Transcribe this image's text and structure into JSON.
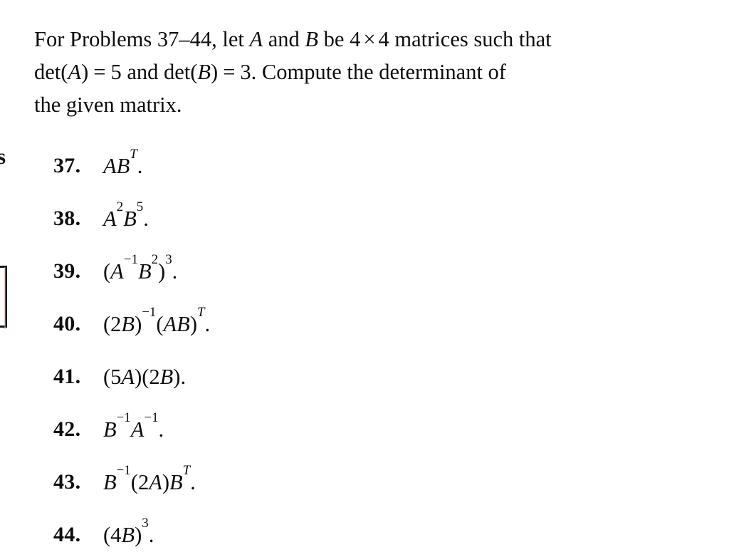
{
  "page": {
    "background_color": "#ffffff",
    "text_color": "#0d0d0d"
  },
  "edge_artifacts": {
    "partial_letter": "s",
    "partial_box_label": ""
  },
  "intro": {
    "line1_a": "For Problems 37–44, let",
    "line1_var1": "A",
    "line1_b": "and",
    "line1_var2": "B",
    "line1_c": "be 4",
    "line1_times": "×",
    "line1_d": "4 matrices such that",
    "line2_det1": "det(",
    "line2_var1": "A",
    "line2_close1": ")",
    "line2_eq1": "=",
    "line2_val1": "5",
    "line2_and": "and",
    "line2_det2": "det(",
    "line2_var2": "B",
    "line2_close2": ")",
    "line2_eq2": "=",
    "line2_val2": "3.",
    "line2_rest": "Compute the determinant of",
    "line3": "the given matrix."
  },
  "problems": [
    {
      "number": "37.",
      "expression": "AB^T.",
      "parts": [
        {
          "t": "A",
          "style": "mi"
        },
        {
          "t": "B",
          "style": "mi"
        },
        {
          "t": "T",
          "style": "sup-italic"
        },
        {
          "t": ".",
          "style": "dot"
        }
      ]
    },
    {
      "number": "38.",
      "expression": "A^2B^5.",
      "parts": [
        {
          "t": "A",
          "style": "mi"
        },
        {
          "t": "2",
          "style": "sup-upright"
        },
        {
          "t": "B",
          "style": "mi"
        },
        {
          "t": "5",
          "style": "sup-upright"
        },
        {
          "t": ".",
          "style": "dot"
        }
      ]
    },
    {
      "number": "39.",
      "expression": "(A^-1 B^2)^3.",
      "parts": [
        {
          "t": "(",
          "style": "paren"
        },
        {
          "t": "A",
          "style": "mi"
        },
        {
          "t": "−1",
          "style": "sup-upright"
        },
        {
          "t": "B",
          "style": "mi"
        },
        {
          "t": "2",
          "style": "sup-upright"
        },
        {
          "t": ")",
          "style": "paren"
        },
        {
          "t": "3",
          "style": "sup-upright"
        },
        {
          "t": ".",
          "style": "dot"
        }
      ]
    },
    {
      "number": "40.",
      "expression": "(2B)^-1(AB)^T.",
      "parts": [
        {
          "t": "(",
          "style": "paren"
        },
        {
          "t": "2",
          "style": "digit"
        },
        {
          "t": "B",
          "style": "mi"
        },
        {
          "t": ")",
          "style": "paren"
        },
        {
          "t": "−1",
          "style": "sup-upright"
        },
        {
          "t": "(",
          "style": "paren"
        },
        {
          "t": "A",
          "style": "mi"
        },
        {
          "t": "B",
          "style": "mi"
        },
        {
          "t": ")",
          "style": "paren"
        },
        {
          "t": "T",
          "style": "sup-italic"
        },
        {
          "t": ".",
          "style": "dot"
        }
      ]
    },
    {
      "number": "41.",
      "expression": "(5A)(2B).",
      "parts": [
        {
          "t": "(",
          "style": "paren"
        },
        {
          "t": "5",
          "style": "digit"
        },
        {
          "t": "A",
          "style": "mi"
        },
        {
          "t": ")",
          "style": "paren"
        },
        {
          "t": "(",
          "style": "paren"
        },
        {
          "t": "2",
          "style": "digit"
        },
        {
          "t": "B",
          "style": "mi"
        },
        {
          "t": ")",
          "style": "paren"
        },
        {
          "t": ".",
          "style": "dot"
        }
      ]
    },
    {
      "number": "42.",
      "expression": "B^-1A^-1.",
      "parts": [
        {
          "t": "B",
          "style": "mi"
        },
        {
          "t": "−1",
          "style": "sup-upright"
        },
        {
          "t": "A",
          "style": "mi"
        },
        {
          "t": "−1",
          "style": "sup-upright"
        },
        {
          "t": ".",
          "style": "dot"
        }
      ]
    },
    {
      "number": "43.",
      "expression": "B^-1(2A)B^T.",
      "parts": [
        {
          "t": "B",
          "style": "mi"
        },
        {
          "t": "−1",
          "style": "sup-upright"
        },
        {
          "t": "(",
          "style": "paren"
        },
        {
          "t": "2",
          "style": "digit"
        },
        {
          "t": "A",
          "style": "mi"
        },
        {
          "t": ")",
          "style": "paren"
        },
        {
          "t": "B",
          "style": "mi"
        },
        {
          "t": "T",
          "style": "sup-italic"
        },
        {
          "t": ".",
          "style": "dot"
        }
      ]
    },
    {
      "number": "44.",
      "expression": "(4B)^3.",
      "parts": [
        {
          "t": "(",
          "style": "paren"
        },
        {
          "t": "4",
          "style": "digit"
        },
        {
          "t": "B",
          "style": "mi"
        },
        {
          "t": ")",
          "style": "paren"
        },
        {
          "t": "3",
          "style": "sup-upright"
        },
        {
          "t": ".",
          "style": "dot"
        }
      ]
    }
  ]
}
